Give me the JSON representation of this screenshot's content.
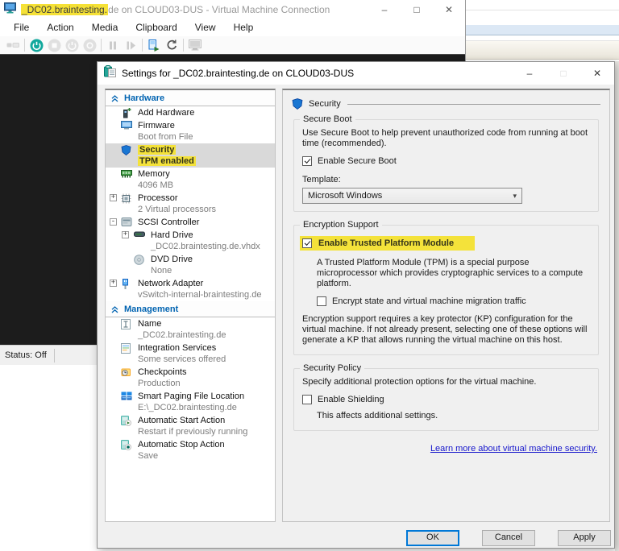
{
  "vm_window": {
    "title_highlighted": "_DC02.braintesting.",
    "title_rest": "de on CLOUD03-DUS - Virtual Machine Connection",
    "menu": [
      "File",
      "Action",
      "Media",
      "Clipboard",
      "View",
      "Help"
    ],
    "toolbar": [
      {
        "icon": "ctrl-alt-del-icon",
        "enabled": false
      },
      {
        "sep": true
      },
      {
        "icon": "start-icon",
        "enabled": true
      },
      {
        "icon": "turn-off-icon",
        "enabled": false
      },
      {
        "icon": "shut-down-icon",
        "enabled": false
      },
      {
        "icon": "save-state-icon",
        "enabled": false
      },
      {
        "sep": true
      },
      {
        "icon": "pause-icon",
        "enabled": false
      },
      {
        "icon": "step-icon",
        "enabled": false
      },
      {
        "sep": true
      },
      {
        "icon": "checkpoint-icon",
        "enabled": true
      },
      {
        "icon": "revert-icon",
        "enabled": true
      },
      {
        "sep": true
      },
      {
        "icon": "enhanced-session-icon",
        "enabled": false
      }
    ],
    "status": "Status: Off"
  },
  "dialog": {
    "title": "Settings for _DC02.braintesting.de on CLOUD03-DUS",
    "sidebar": {
      "items": [
        {
          "type": "header",
          "label": "Hardware"
        },
        {
          "icon": "add-hardware-icon",
          "label": "Add Hardware"
        },
        {
          "icon": "firmware-icon",
          "label": "Firmware",
          "sub": "Boot from File"
        },
        {
          "icon": "security-shield-icon",
          "label": "Security",
          "sub": "TPM enabled",
          "selected": true,
          "highlighted": true
        },
        {
          "icon": "memory-icon",
          "label": "Memory",
          "sub": "4096 MB"
        },
        {
          "icon": "processor-icon",
          "label": "Processor",
          "sub": "2 Virtual processors",
          "expand": "+"
        },
        {
          "icon": "scsi-controller-icon",
          "label": "SCSI Controller",
          "expand": "-"
        },
        {
          "icon": "hard-drive-icon",
          "label": "Hard Drive",
          "sub": "_DC02.braintesting.de.vhdx",
          "expand": "+",
          "indent": 1
        },
        {
          "icon": "dvd-drive-icon",
          "label": "DVD Drive",
          "sub": "None",
          "indent": 1
        },
        {
          "icon": "network-adapter-icon",
          "label": "Network Adapter",
          "sub": "vSwitch-internal-braintesting.de",
          "expand": "+"
        },
        {
          "type": "header",
          "label": "Management"
        },
        {
          "icon": "name-icon",
          "label": "Name",
          "sub": "_DC02.braintesting.de"
        },
        {
          "icon": "integration-services-icon",
          "label": "Integration Services",
          "sub": "Some services offered"
        },
        {
          "icon": "checkpoints-icon",
          "label": "Checkpoints",
          "sub": "Production"
        },
        {
          "icon": "smart-paging-icon",
          "label": "Smart Paging File Location",
          "sub": "E:\\_DC02.braintesting.de"
        },
        {
          "icon": "auto-start-icon",
          "label": "Automatic Start Action",
          "sub": "Restart if previously running"
        },
        {
          "icon": "auto-stop-icon",
          "label": "Automatic Stop Action",
          "sub": "Save"
        }
      ]
    },
    "security_pane": {
      "header": "Security",
      "secure_boot": {
        "group_label": "Secure Boot",
        "description": "Use Secure Boot to help prevent unauthorized code from running at boot time (recommended).",
        "checkbox_label": "Enable Secure Boot",
        "checkbox_checked": true,
        "template_label": "Template:",
        "template_value": "Microsoft Windows"
      },
      "encryption": {
        "group_label": "Encryption Support",
        "tpm_checkbox_label": "Enable Trusted Platform Module",
        "tpm_checkbox_checked": true,
        "tpm_description": "A Trusted Platform Module (TPM) is a special purpose microprocessor which provides cryptographic services to a compute platform.",
        "encrypt_checkbox_label": "Encrypt state and virtual machine migration traffic",
        "encrypt_checkbox_checked": false,
        "kp_description": "Encryption support requires a key protector (KP) configuration for the virtual machine. If not already present, selecting one of these options will generate a KP that allows running the virtual machine on this host."
      },
      "policy": {
        "group_label": "Security Policy",
        "description": "Specify additional protection options for the virtual machine.",
        "shielding_checkbox_label": "Enable Shielding",
        "shielding_checkbox_checked": false,
        "note": "This affects additional settings."
      },
      "link_label": "Learn more about virtual machine security."
    },
    "buttons": {
      "ok": "OK",
      "cancel": "Cancel",
      "apply": "Apply"
    }
  },
  "colors": {
    "highlight_yellow": "#f4e23a",
    "section_header_blue": "#0063b1",
    "link_blue": "#1717cc",
    "selected_row_gray": "#d9d9d9",
    "focus_border_blue": "#0078d7"
  }
}
